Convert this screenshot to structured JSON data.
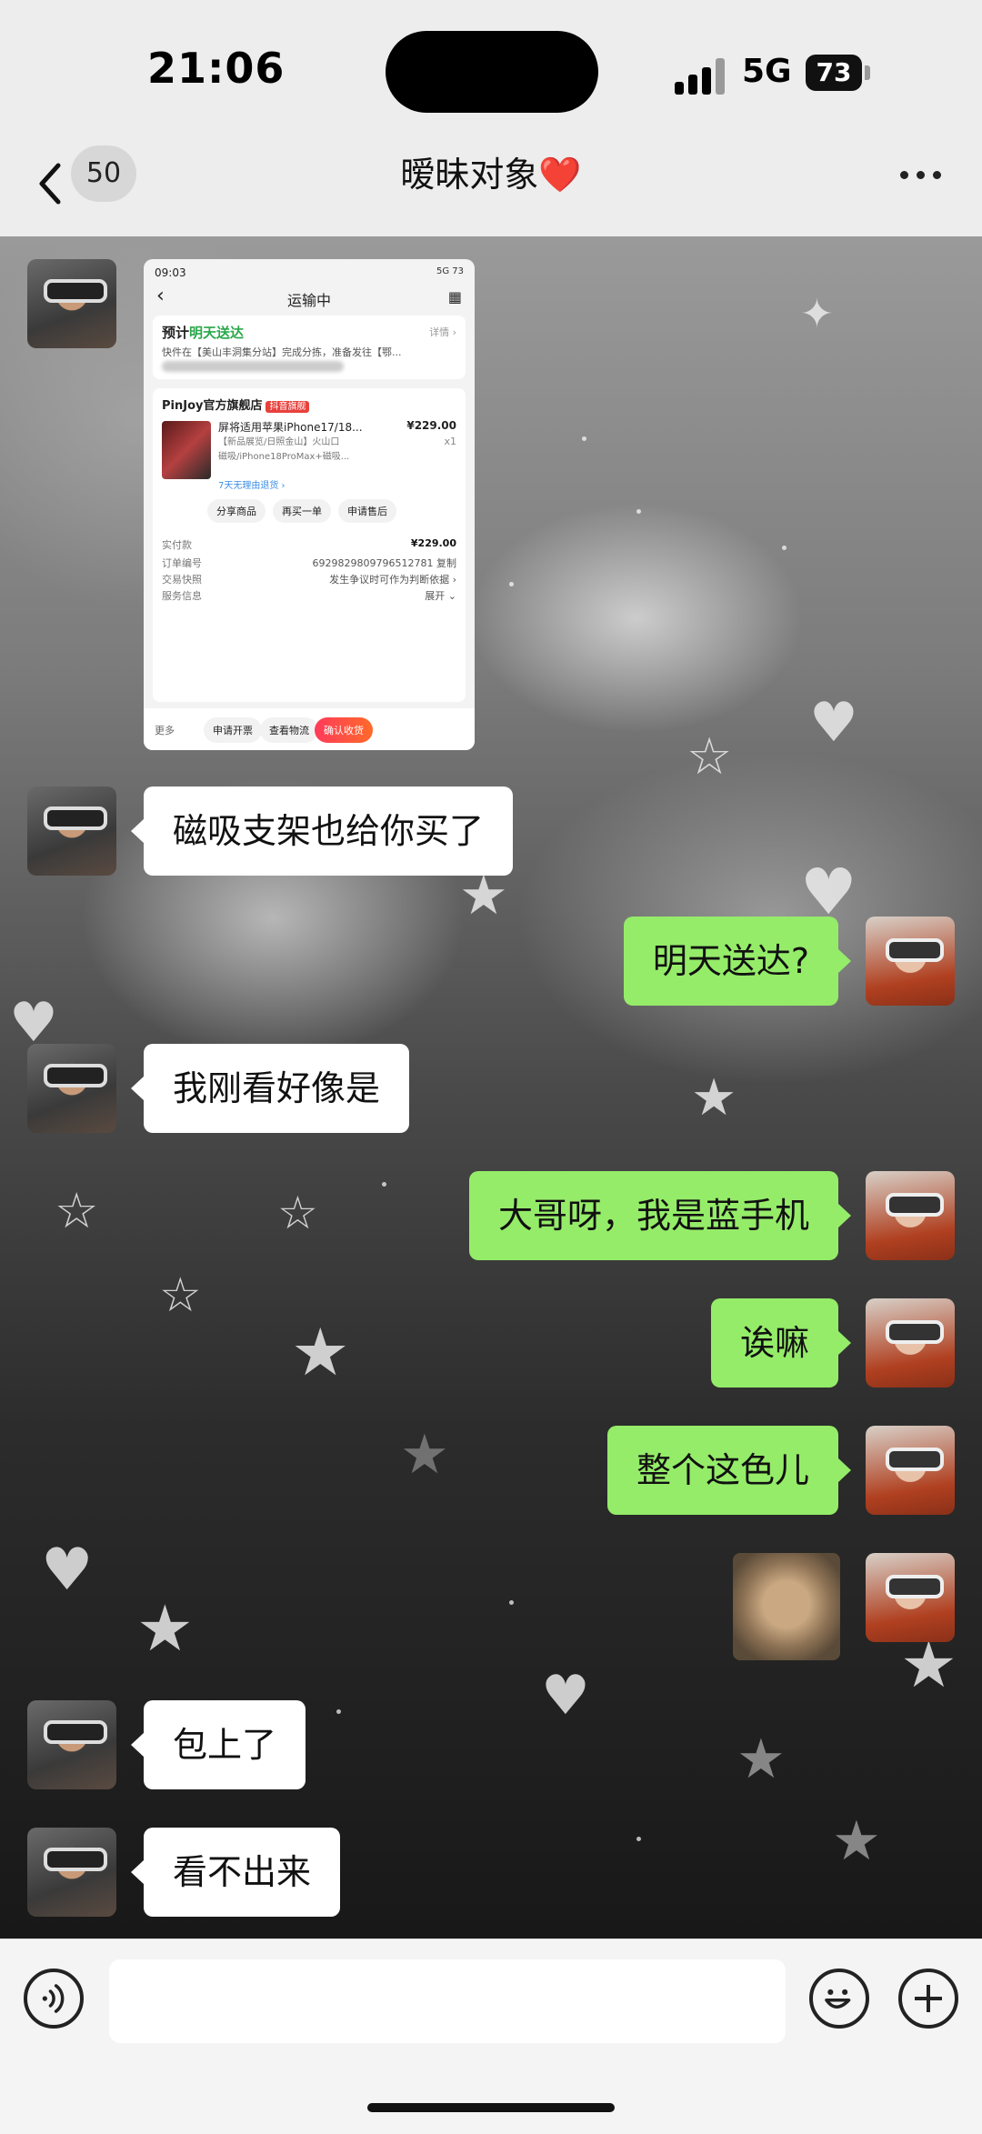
{
  "status_bar": {
    "time": "21:06",
    "network": "5G",
    "battery": "73"
  },
  "nav": {
    "unread_count": "50",
    "title": "暧昧对象",
    "title_emoji": "❤️"
  },
  "shared_screenshot": {
    "status_time": "09:03",
    "status_right": "5G 73",
    "header_title": "运输中",
    "eta_prefix": "预计",
    "eta_highlight": "明天送达",
    "detail_link": "详情 ›",
    "tracking_text": "快件在【美山丰洞集分站】完成分拣，准备发往【鄂...",
    "store_name": "PinJoy官方旗舰店",
    "store_badge": "抖音旗舰",
    "product_name": "屏将适用苹果iPhone17/18...",
    "product_price": "¥229.00",
    "product_qty": "x1",
    "product_spec_1": "【新品展览/日照金山】火山口",
    "product_spec_2": "磁吸/iPhone18ProMax+磁吸...",
    "return_policy": "7天无理由退货 ›",
    "actions": [
      "分享商品",
      "再买一单",
      "申请售后"
    ],
    "paid_label": "实付款",
    "paid_value": "¥229.00",
    "order_label": "订单编号",
    "order_value": "6929829809796512781 复制",
    "trade_label": "交易快照",
    "trade_value": "发生争议时可作为判断依据 ›",
    "service_label": "服务信息",
    "service_value": "展开 ⌄",
    "bottom_more": "更多",
    "bottom_buttons": [
      "申请开票",
      "查看物流",
      "确认收货"
    ]
  },
  "messages": [
    {
      "side": "left",
      "text": "磁吸支架也给你买了"
    },
    {
      "side": "right",
      "text": "明天送达?"
    },
    {
      "side": "left",
      "text": "我刚看好像是"
    },
    {
      "side": "right",
      "text": "大哥呀，我是蓝手机"
    },
    {
      "side": "right",
      "text": "诶嘛"
    },
    {
      "side": "right",
      "text": "整个这色儿"
    },
    {
      "side": "right",
      "type": "sticker"
    },
    {
      "side": "left",
      "text": "包上了"
    },
    {
      "side": "left",
      "text": "看不出来"
    }
  ],
  "colors": {
    "bubble_right": "#95ec69",
    "bubble_left": "#ffffff",
    "nav_bg": "#ededed",
    "heart": "#e02020"
  },
  "icons": [
    "back-chevron-icon",
    "more-dots-icon",
    "voice-icon",
    "emoji-icon",
    "plus-icon",
    "signal-icon",
    "battery-icon"
  ]
}
